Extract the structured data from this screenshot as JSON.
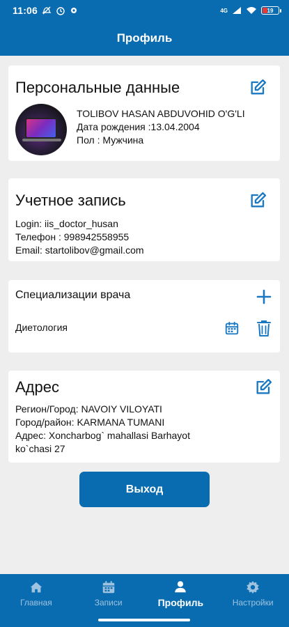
{
  "status": {
    "time": "11:06",
    "battery": "19",
    "network": "4G"
  },
  "header": {
    "title": "Профиль"
  },
  "personal": {
    "title": "Персональные данные",
    "name": "TOLIBOV HASAN ABDUVOHID O'G'LI",
    "birth": "Дата рождения :13.04.2004",
    "gender": "Пол : Мужчина"
  },
  "account": {
    "title": "Учетное запись",
    "login": "Login: iis_doctor_husan",
    "phone": "Телефон : 998942558955",
    "email": "Email: startolibov@gmail.com"
  },
  "specializations": {
    "title": "Специализации врача",
    "items": [
      {
        "label": "Диетология"
      }
    ]
  },
  "address": {
    "title": "Адрес",
    "region": "Регион/Город: NAVOIY VILOYATI",
    "district": "Город/район: KARMANA TUMANI",
    "street_line1": "Адрес: Xoncharbog` mahallasi Barhayot",
    "street_line2": "ko`chasi 27"
  },
  "actions": {
    "exit": "Выход"
  },
  "nav": {
    "items": [
      {
        "label": "Главная",
        "icon": "home-icon"
      },
      {
        "label": "Записи",
        "icon": "calendar-icon"
      },
      {
        "label": "Профиль",
        "icon": "person-icon"
      },
      {
        "label": "Настройки",
        "icon": "gear-icon"
      }
    ],
    "active": "Профиль"
  },
  "colors": {
    "primary": "#0a6cb0",
    "background": "#eeeeee",
    "card": "#ffffff",
    "accent_icon": "#1a78c2"
  }
}
